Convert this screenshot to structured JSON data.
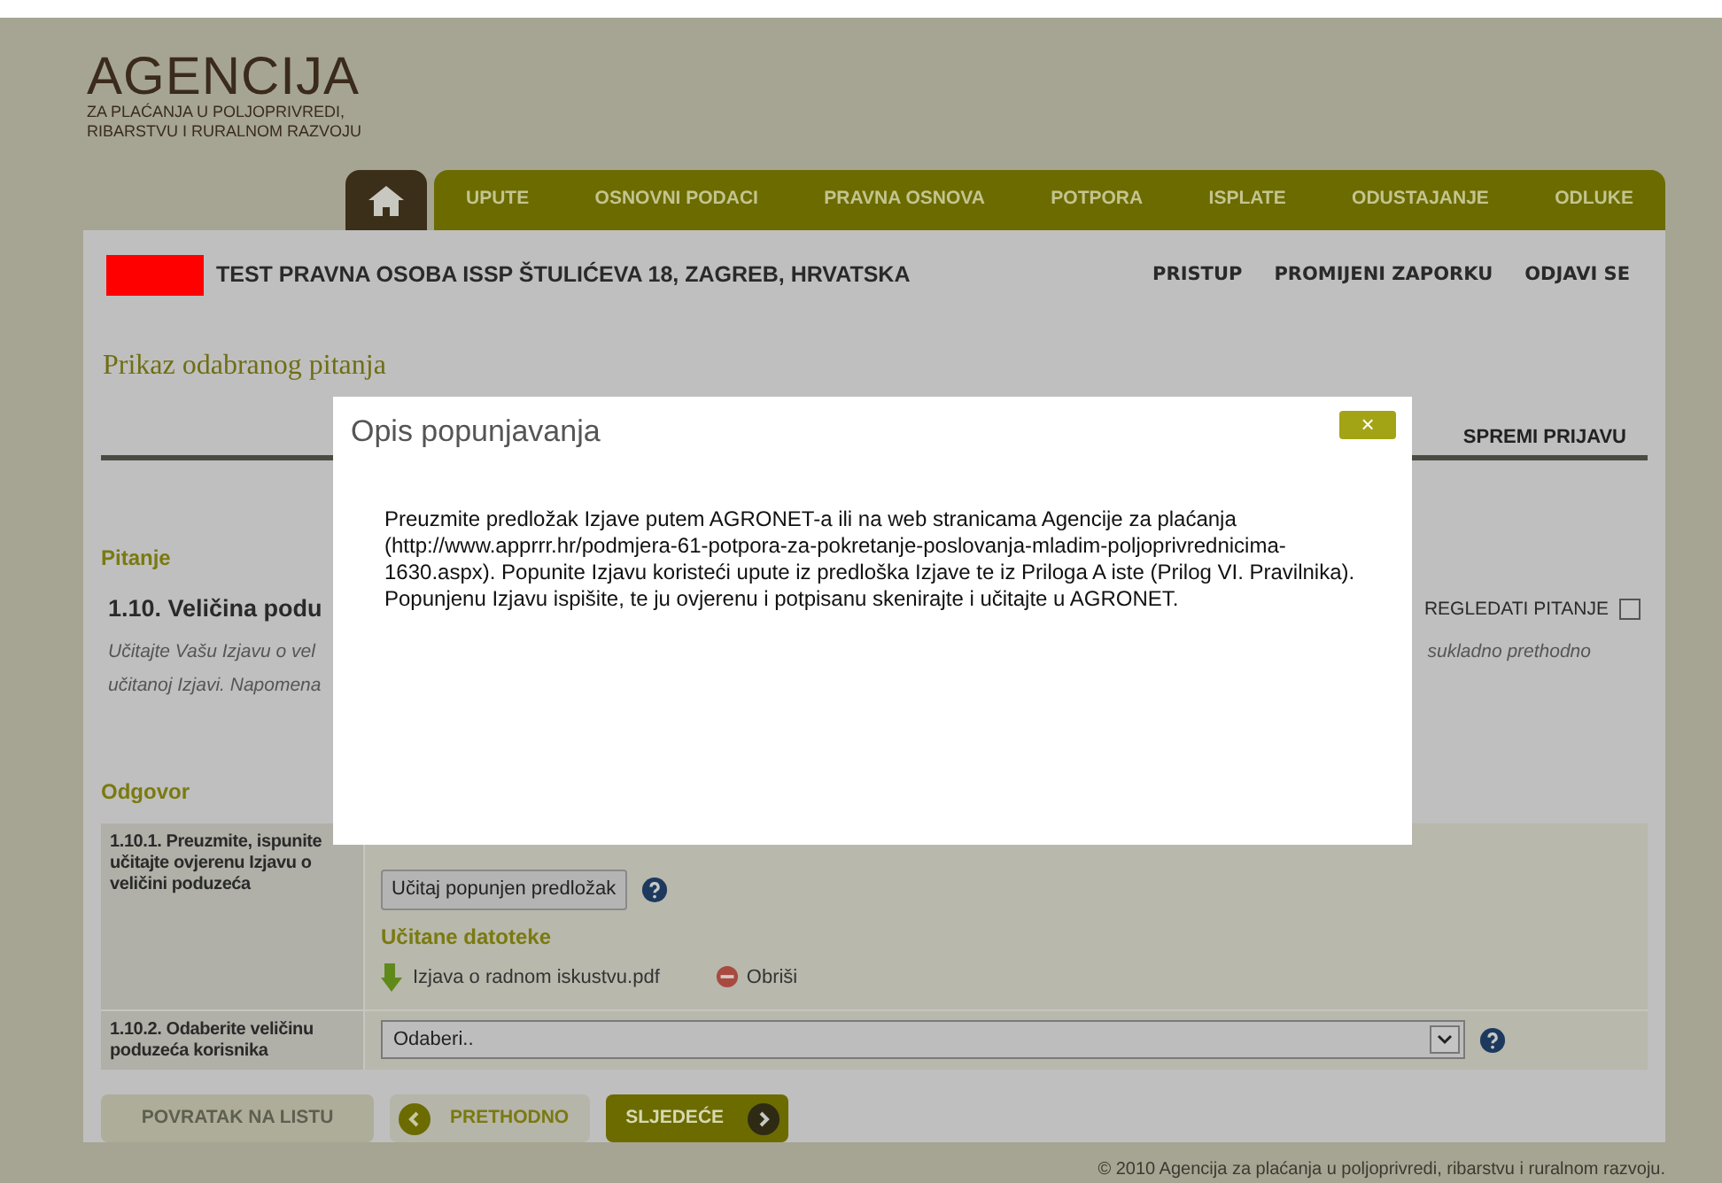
{
  "logo": {
    "title": "AGENCIJA",
    "subtitle_lines": [
      "ZA PLAĆANJA U POLJOPRIVREDI,",
      "RIBARSTVU I RURALNOM RAZVOJU"
    ]
  },
  "nav": {
    "items": [
      "UPUTE",
      "OSNOVNI PODACI",
      "PRAVNA OSNOVA",
      "POTPORA",
      "ISPLATE",
      "ODUSTAJANJE",
      "ODLUKE"
    ]
  },
  "user_bar": {
    "name": "TEST PRAVNA OSOBA ISSP ŠTULIĆEVA 18, ZAGREB, HRVATSKA",
    "links": [
      "PRISTUP",
      "PROMIJENI ZAPORKU",
      "ODJAVI SE"
    ]
  },
  "page_title": "Prikaz odabranog pitanja",
  "save_link": "SPREMI PRIJAVU",
  "question": {
    "heading": "Pitanje",
    "title": "1.10. Veličina podu",
    "review_label": "REGLEDATI PITANJE",
    "review_checked": false,
    "description_left": [
      "Učitajte Vašu Izjavu o vel",
      "učitanoj Izjavi. Napomena"
    ],
    "description_right": "sukladno prethodno"
  },
  "answer": {
    "heading": "Odgovor",
    "rows": [
      {
        "kind": "upload",
        "label": "1.10.1. Preuzmite, ispunite učitajte ovjerenu Izjavu o veličini poduzeća",
        "button": "Učitaj popunjen predložak",
        "files_heading": "Učitane datoteke",
        "file": "Izjava o radnom iskustvu.pdf",
        "delete": "Obriši"
      },
      {
        "kind": "select",
        "label": "1.10.2. Odaberite veličinu poduzeća korisnika",
        "value": "Odaberi.."
      }
    ]
  },
  "buttons": {
    "back": "POVRATAK NA LISTU",
    "previous": "PRETHODNO",
    "next": "SLJEDEĆE"
  },
  "footer": "© 2010 Agencija za plaćanja u poljoprivredi, ribarstvu i ruralnom razvoju.",
  "modal": {
    "title": "Opis popunjavanja",
    "close": "×",
    "text": "Preuzmite predložak Izjave putem AGRONET-a ili na web stranicama Agencije za plaćanja (http://www.apprrr.hr/podmjera-61-potpora-za-pokretanje-poslovanja-mladim-poljoprivrednicima-1630.aspx). Popunite Izjavu koristeći upute iz predloška Izjave te iz Priloga A iste (Prilog VI. Pravilnika). Popunjenu Izjavu ispišite, te ju ovjerenu i potpisanu skenirajte i učitajte u AGRONET."
  }
}
